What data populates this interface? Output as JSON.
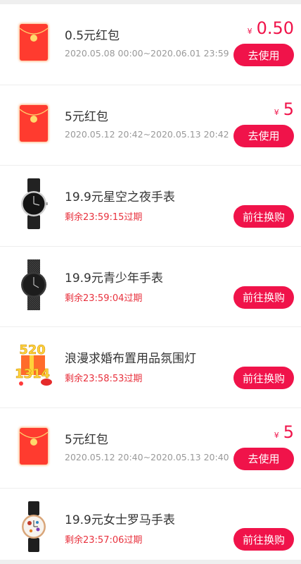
{
  "items": [
    {
      "type": "redpacket",
      "title": "0.5元红包",
      "sub": "2020.05.08 00:00~2020.06.01 23:59",
      "currency": "¥",
      "price": "0.50",
      "button": "去使用"
    },
    {
      "type": "redpacket",
      "title": "5元红包",
      "sub": "2020.05.12 20:42~2020.05.13 20:42",
      "currency": "¥",
      "price": "5",
      "button": "去使用"
    },
    {
      "type": "watch-black",
      "title": "19.9元星空之夜手表",
      "sub": "剩余23:59:15过期",
      "button": "前往换购"
    },
    {
      "type": "watch-mesh",
      "title": "19.9元青少年手表",
      "sub": "剩余23:59:04过期",
      "button": "前往换购"
    },
    {
      "type": "decor",
      "title": "浪漫求婚布置用品氛围灯",
      "sub": "剩余23:58:53过期",
      "button": "前往换购",
      "decor_top": "520",
      "decor_bottom": "1314"
    },
    {
      "type": "redpacket",
      "title": "5元红包",
      "sub": "2020.05.12 20:40~2020.05.13 20:40",
      "currency": "¥",
      "price": "5",
      "button": "去使用"
    },
    {
      "type": "watch-floral",
      "title": "19.9元女士罗马手表",
      "sub": "剩余23:57:06过期",
      "button": "前往换购"
    }
  ],
  "colors": {
    "accent": "#f0134a",
    "countdown": "#e8313d",
    "muted": "#999999"
  },
  "icons": {
    "redpacket": "red-packet-icon",
    "watch": "wristwatch-icon",
    "decor": "proposal-decor-icon"
  }
}
